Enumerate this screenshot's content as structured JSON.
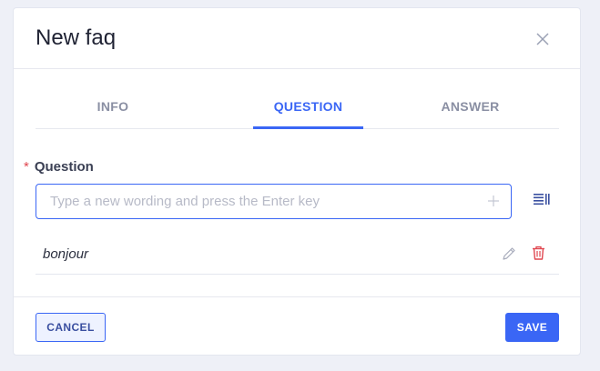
{
  "modal": {
    "title": "New faq"
  },
  "tabs": [
    {
      "label": "INFO",
      "active": false
    },
    {
      "label": "QUESTION",
      "active": true
    },
    {
      "label": "ANSWER",
      "active": false
    }
  ],
  "question_field": {
    "required_mark": "*",
    "label": "Question",
    "placeholder": "Type a new wording and press the Enter key",
    "value": ""
  },
  "wordings": [
    {
      "text": "bonjour"
    }
  ],
  "footer": {
    "cancel_label": "CANCEL",
    "save_label": "SAVE"
  },
  "icons": {
    "close": "close-icon",
    "plus": "plus-icon",
    "list": "list-icon",
    "edit": "pencil-icon",
    "delete": "trash-icon"
  },
  "colors": {
    "accent": "#3a66f5",
    "danger": "#e0464f",
    "background": "#eef0f7"
  }
}
